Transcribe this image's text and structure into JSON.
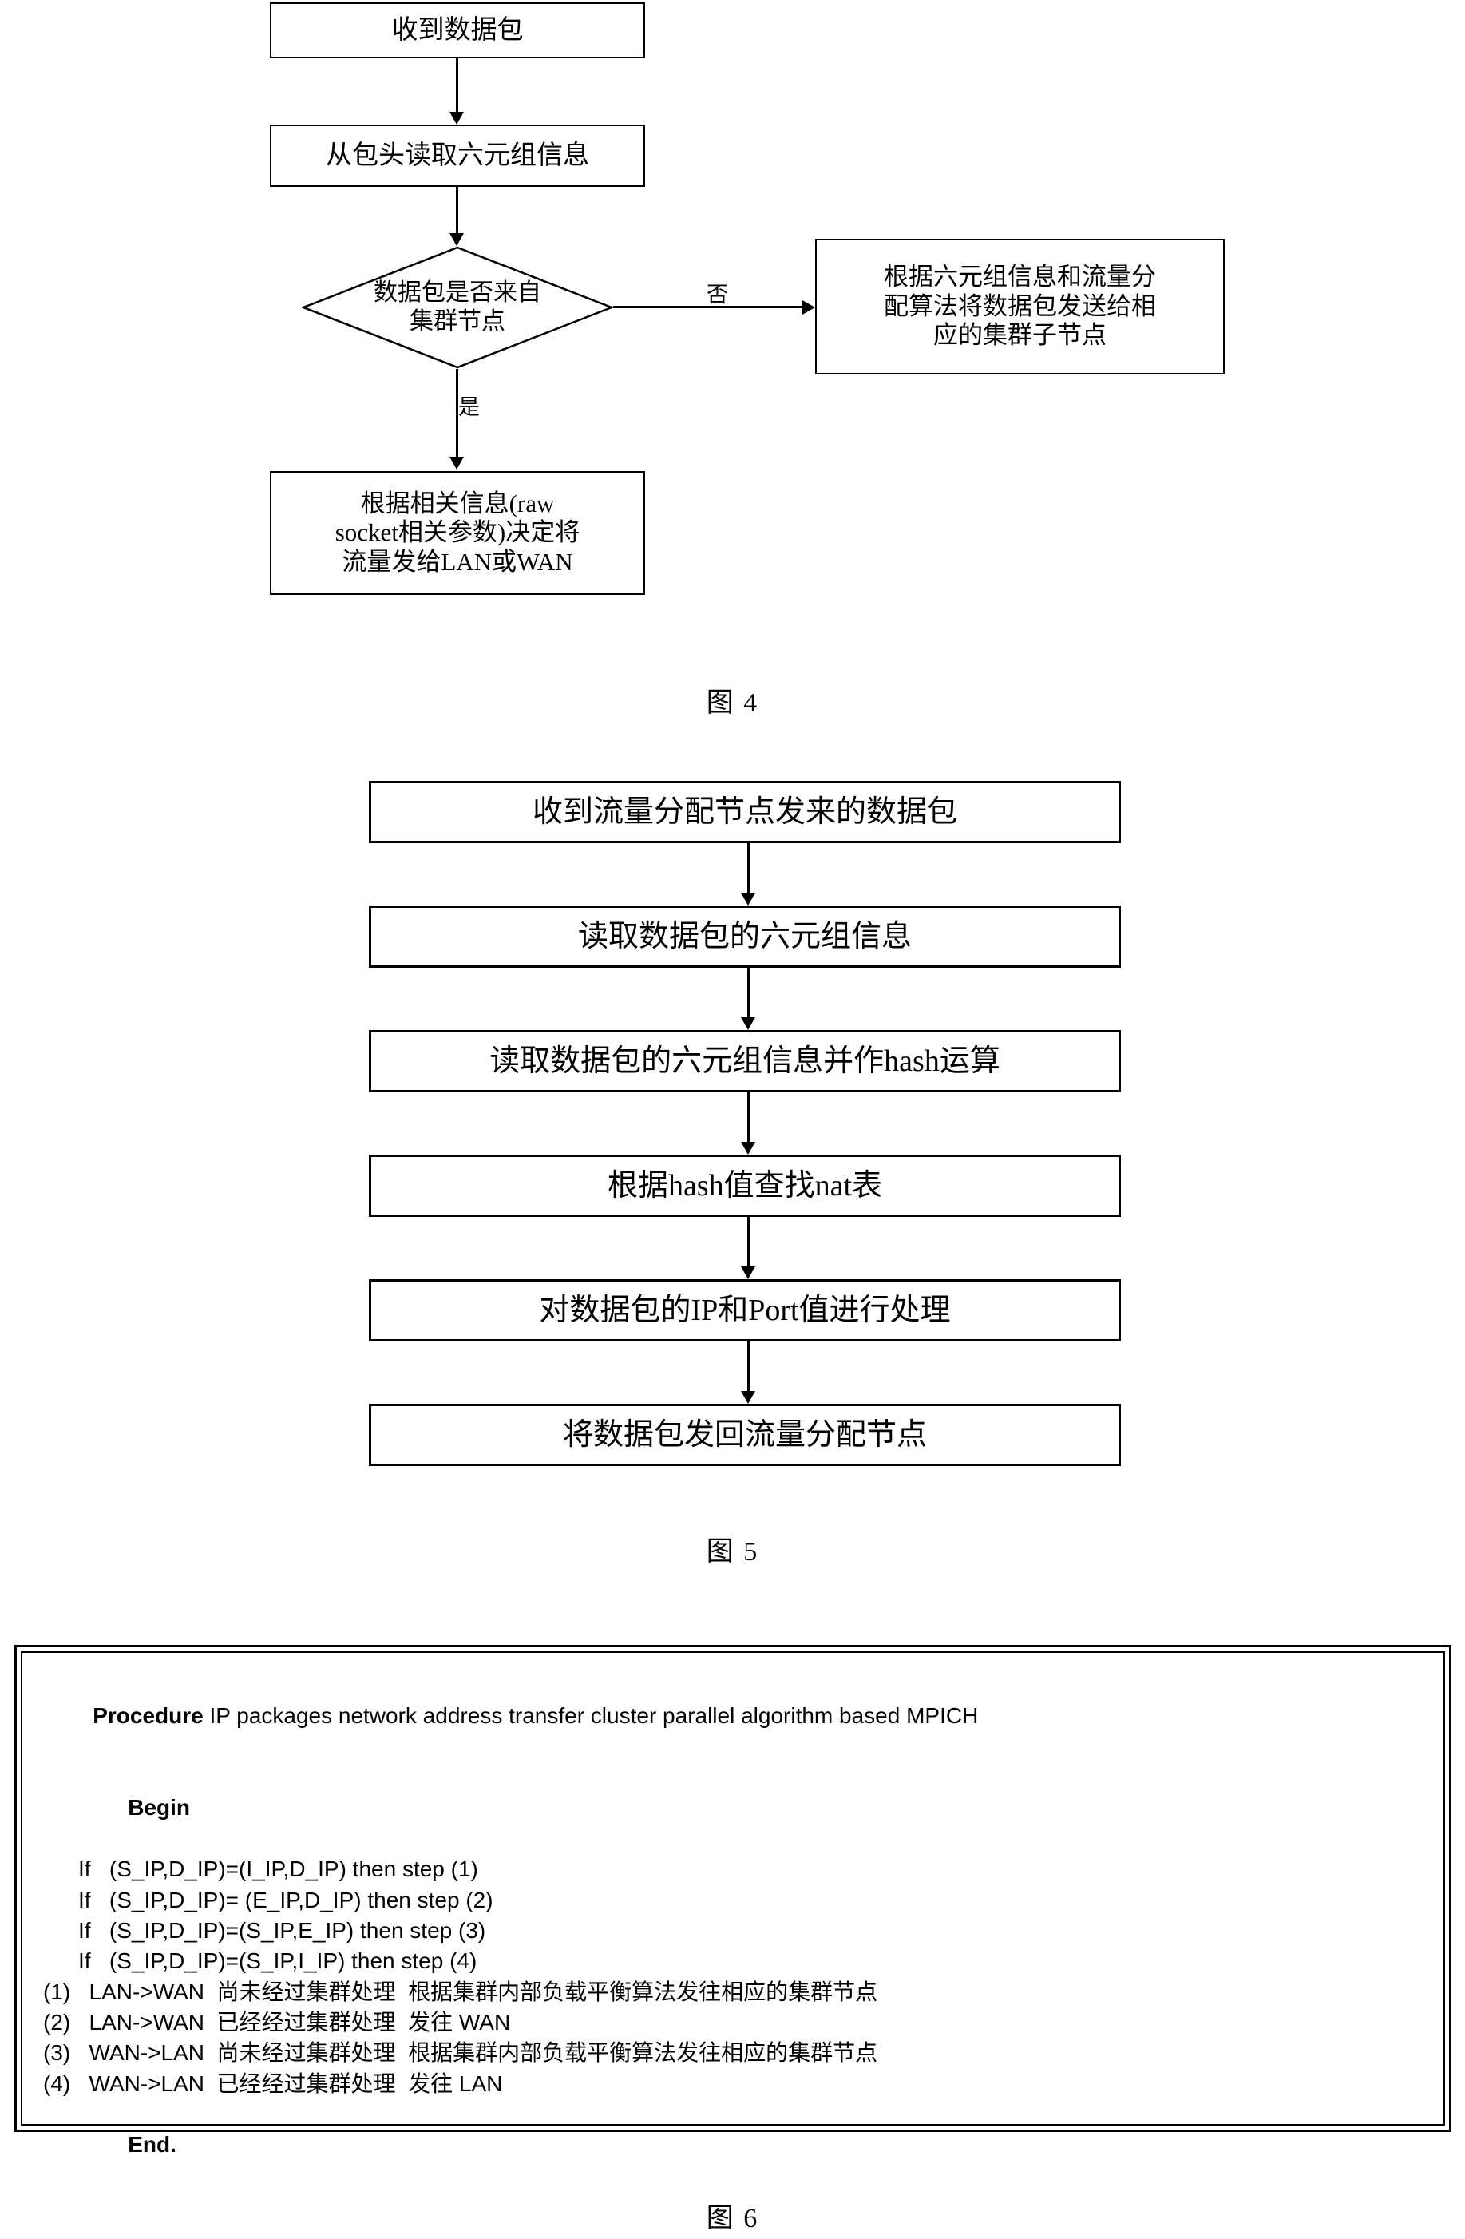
{
  "figure4": {
    "caption": "图 4",
    "nodes": [
      {
        "id": "f4-start",
        "label": "收到数据包"
      },
      {
        "id": "f4-read",
        "label": "从包头读取六元组信息"
      },
      {
        "id": "f4-decision",
        "label": "数据包是否来自\n集群节点"
      },
      {
        "id": "f4-no-box",
        "label": "根据六元组信息和流量分\n配算法将数据包发送给相\n应的集群子节点"
      },
      {
        "id": "f4-yes-box",
        "label": "根据相关信息(raw\nsocket相关参数)决定将\n流量发给LAN或WAN"
      }
    ],
    "edge_labels": {
      "no": "否",
      "yes": "是"
    }
  },
  "figure5": {
    "caption": "图 5",
    "nodes": [
      {
        "id": "f5-1",
        "label": "收到流量分配节点发来的数据包"
      },
      {
        "id": "f5-2",
        "label": "读取数据包的六元组信息"
      },
      {
        "id": "f5-3",
        "label": "读取数据包的六元组信息并作hash运算"
      },
      {
        "id": "f5-4",
        "label": "根据hash值查找nat表"
      },
      {
        "id": "f5-5",
        "label": "对数据包的IP和Port值进行处理"
      },
      {
        "id": "f5-6",
        "label": "将数据包发回流量分配节点"
      }
    ]
  },
  "figure6": {
    "caption": "图 6",
    "code": {
      "procedure_keyword": "Procedure",
      "procedure_title": " IP packages network address transfer cluster parallel algorithm based MPICH",
      "begin_keyword": "Begin",
      "end_keyword": "End.",
      "if_lines": [
        "If   (S_IP,D_IP)=(I_IP,D_IP) then step (1)",
        "If   (S_IP,D_IP)= (E_IP,D_IP) then step (2)",
        "If   (S_IP,D_IP)=(S_IP,E_IP) then step (3)",
        "If   (S_IP,D_IP)=(S_IP,I_IP) then step (4)"
      ],
      "steps": [
        "(1)   LAN->WAN  尚未经过集群处理  根据集群内部负载平衡算法发往相应的集群节点",
        "(2)   LAN->WAN  已经经过集群处理  发往 WAN",
        "(3)   WAN->LAN  尚未经过集群处理  根据集群内部负载平衡算法发往相应的集群节点",
        "(4)   WAN->LAN  已经经过集群处理  发往 LAN"
      ]
    }
  }
}
